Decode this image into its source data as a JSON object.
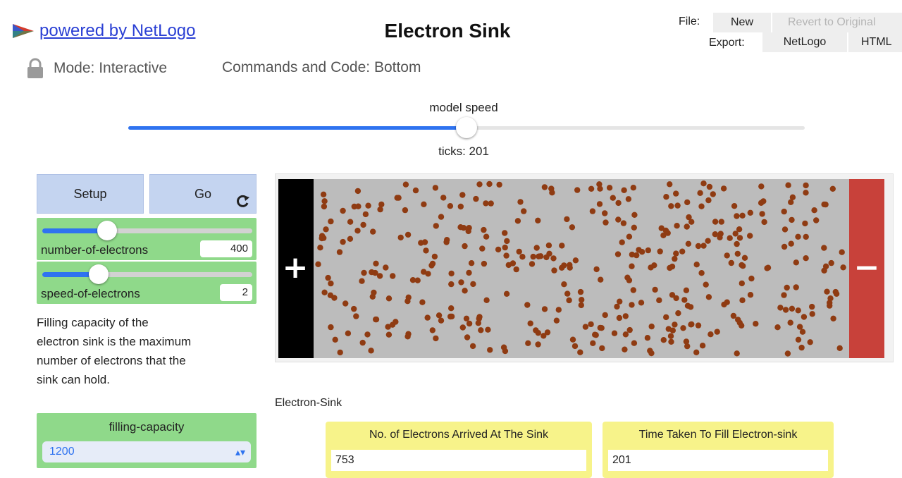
{
  "header": {
    "logo_link_text": "powered by NetLogo",
    "title": "Electron Sink",
    "file_label": "File:",
    "new_label": "New",
    "revert_label": "Revert to Original",
    "export_label": "Export:",
    "export_netlogo_label": "NetLogo",
    "export_html_label": "HTML"
  },
  "toolbar": {
    "mode_label": "Mode: Interactive",
    "commands_label": "Commands and Code: Bottom"
  },
  "speed": {
    "label": "model speed",
    "value_fraction": 0.5,
    "ticks_label": "ticks: 201"
  },
  "buttons": {
    "setup_label": "Setup",
    "go_label": "Go",
    "go_icon": "forever-icon"
  },
  "sliders": [
    {
      "name": "number-of-electrons",
      "value": "400",
      "fraction": 0.31
    },
    {
      "name": "speed-of-electrons",
      "value": "2",
      "fraction": 0.27
    }
  ],
  "note": {
    "text": "Filling capacity of the electron sink is the maximum number of electrons that the sink can hold."
  },
  "chooser": {
    "label": "filling-capacity",
    "value": "1200",
    "arrow_icon": "updown-chevron-icon"
  },
  "world": {
    "positive_terminal_symbol": "+",
    "negative_terminal_symbol": "−",
    "electron_count": 400,
    "colors": {
      "left_terminal": "#000000",
      "field": "#bcbcbc",
      "right_terminal": "#c8413a",
      "electron": "#8f3b12"
    }
  },
  "plot": {
    "label": "Electron-Sink"
  },
  "monitors": [
    {
      "label": "No. of Electrons Arrived At The Sink",
      "value": "753"
    },
    {
      "label": "Time Taken To Fill Electron-sink",
      "value": "201"
    }
  ],
  "colors": {
    "link": "#2a3fd4",
    "slider_fill": "#2f73f0",
    "widget_green": "#8fd98a",
    "button_blue": "#c4d4f0",
    "monitor_yellow": "#f7f38a"
  }
}
